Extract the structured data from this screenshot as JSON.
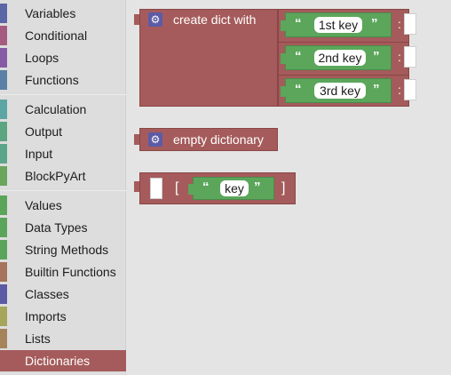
{
  "toolbox": {
    "categories": [
      {
        "label": "Variables",
        "color": "#5b67a5"
      },
      {
        "label": "Conditional",
        "color": "#a55b80"
      },
      {
        "label": "Loops",
        "color": "#855ba5"
      },
      {
        "label": "Functions",
        "color": "#5b80a5"
      },
      {
        "label": "Calculation",
        "color": "#5ba5a5"
      },
      {
        "label": "Output",
        "color": "#5ba580"
      },
      {
        "label": "Input",
        "color": "#5ba58b"
      },
      {
        "label": "BlockPyArt",
        "color": "#6aa55b"
      },
      {
        "label": "Values",
        "color": "#5ba55b"
      },
      {
        "label": "Data Types",
        "color": "#5ba55b"
      },
      {
        "label": "String Methods",
        "color": "#5ba55b"
      },
      {
        "label": "Builtin Functions",
        "color": "#a5745b"
      },
      {
        "label": "Classes",
        "color": "#5b5ba5"
      },
      {
        "label": "Imports",
        "color": "#a5a55b"
      },
      {
        "label": "Lists",
        "color": "#a5845b"
      },
      {
        "label": "Dictionaries",
        "color": "#a55b5b"
      }
    ],
    "selected": "Dictionaries"
  },
  "workspace": {
    "create_dict": {
      "label": "create dict with",
      "keys": [
        "1st key",
        "2nd key",
        "3rd key"
      ],
      "colon": ":"
    },
    "empty_dict": {
      "label": "empty dictionary"
    },
    "dict_access": {
      "open_bracket": "[",
      "key": "key",
      "close_bracket": "]"
    },
    "quote_open": "“",
    "quote_close": "”",
    "gear_icon": "⚙"
  },
  "colors": {
    "dict_block": "#a55b5b",
    "text_block": "#5ba65b",
    "mutator": "#5b5ba6",
    "selected_category": "#a55b5b"
  }
}
